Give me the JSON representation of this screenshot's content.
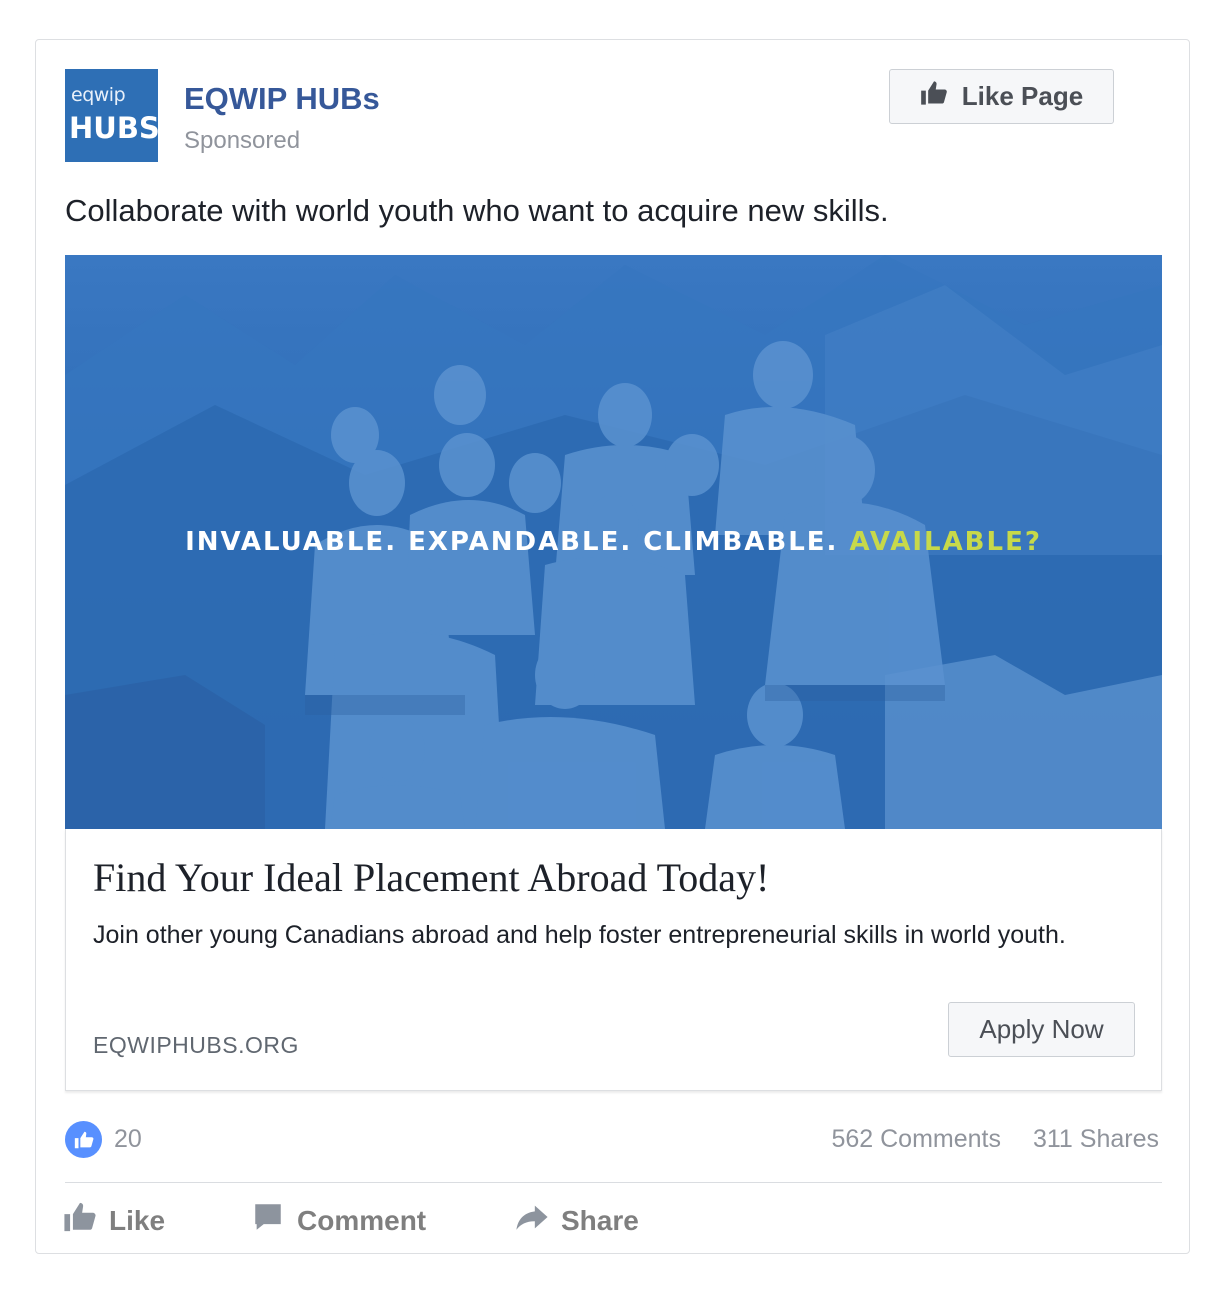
{
  "post": {
    "logo": {
      "line1": "eqwip",
      "line2": "HUBS"
    },
    "page_name": "EQWIP HUBs",
    "sponsored_label": "Sponsored",
    "like_page_label": "Like Page",
    "caption": "Collaborate with world youth who want to acquire new skills.",
    "image": {
      "overlay_text": "INVALUABLE. EXPANDABLE. CLIMBABLE.",
      "overlay_accent": "AVAILABLE?",
      "tint_color": "#2f6db7",
      "accent_color": "#c7d94a"
    },
    "link": {
      "title": "Find Your Ideal Placement Abroad Today!",
      "description": "Join other young Canadians abroad and help foster entrepreneurial skills in world youth.",
      "domain": "EQWIPHUBS.ORG",
      "cta_label": "Apply Now"
    },
    "stats": {
      "reaction_count": "20",
      "comments": "562 Comments",
      "shares": "311 Shares"
    },
    "actions": {
      "like": "Like",
      "comment": "Comment",
      "share": "Share"
    }
  }
}
